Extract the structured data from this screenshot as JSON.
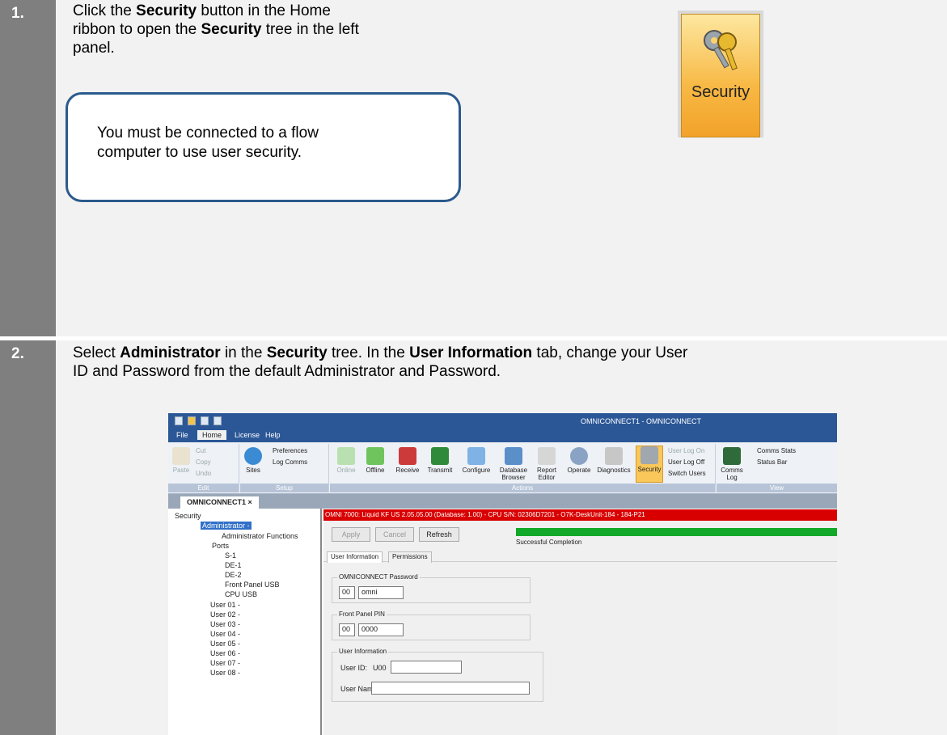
{
  "steps": [
    {
      "num": "1.",
      "pre1": "Click the ",
      "b1": "Security",
      "mid1": " button in the Home",
      "line2a": "ribbon to open the ",
      "b2": "Security",
      "line2b": " tree in the left",
      "line3": "panel."
    },
    {
      "num": "2.",
      "l1a": "Select ",
      "b1": "Administrator",
      "l1b": " in the ",
      "b2": "Security",
      "l1c": " tree. In the ",
      "b3": "User Information",
      "l1d": " tab, change your User",
      "l2": "ID and Password from the default Administrator and Password."
    }
  ],
  "note": {
    "line1": "You must be connected to a flow",
    "line2": "computer to use user security."
  },
  "security_button": {
    "label": "Security",
    "icon": "keys-icon"
  },
  "app": {
    "title": "OMNICONNECT1 - OMNICONNECT",
    "menu": [
      "File",
      "Home",
      "License",
      "Help"
    ],
    "ribbon": {
      "edit": {
        "paste": "Paste",
        "cut": "Cut",
        "copy": "Copy",
        "undo": "Undo",
        "group": "Edit"
      },
      "setup": {
        "sites": "Sites",
        "preferences": "Preferences",
        "log_comms": "Log Comms",
        "group": "Setup"
      },
      "actions": {
        "online": "Online",
        "offline": "Offline",
        "receive": "Receive",
        "transmit": "Transmit",
        "configure": "Configure",
        "database_browser": "Database Browser",
        "report_editor": "Report Editor",
        "operate": "Operate",
        "diagnostics": "Diagnostics",
        "security": "Security",
        "user_log_on": "User Log On",
        "user_log_off": "User Log Off",
        "switch_users": "Switch Users",
        "group": "Actions"
      },
      "view": {
        "comms_log": "Comms Log",
        "comms_stats": "Comms Stats",
        "status_bar": "Status Bar",
        "group": "View"
      }
    },
    "doc_tab": "OMNICONNECT1",
    "tree": [
      "Security",
      "Administrator -",
      "Administrator Functions",
      "Ports",
      "S-1",
      "DE-1",
      "DE-2",
      "Front Panel USB",
      "CPU USB",
      "User 01 -",
      "User 02 -",
      "User 03 -",
      "User 04 -",
      "User 05 -",
      "User 06 -",
      "User 07 -",
      "User 08 -"
    ],
    "status_bar": "OMNI 7000:  Liquid KF US 2.05.05.00 (Database: 1.00) - CPU S/N: 02306D7201 - O7K-DeskUnit-184 - 184-P21",
    "buttons": {
      "apply": "Apply",
      "cancel": "Cancel",
      "refresh": "Refresh"
    },
    "completion": "Successful Completion",
    "tabs": [
      "User Information",
      "Permissions"
    ],
    "omni_pw": {
      "legend": "OMNICONNECT Password",
      "level": "00",
      "value": "omni"
    },
    "pin": {
      "legend": "Front Panel PIN",
      "level": "00",
      "value": "0000"
    },
    "user_info": {
      "legend": "User Information",
      "user_id_label": "User ID:",
      "user_id_prefix": "U00",
      "user_id_value": "",
      "user_name_label": "User Name:",
      "user_name_value": ""
    }
  }
}
